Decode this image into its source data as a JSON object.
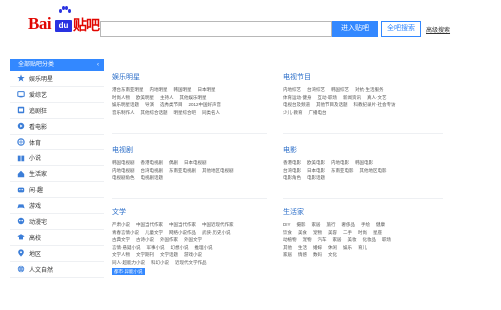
{
  "header": {
    "logo_text_bai": "Bai",
    "logo_text_du": "du",
    "logo_text_tieba": "贴吧",
    "search_placeholder": "",
    "search_button": "进入贴吧",
    "post_button": "全吧搜索",
    "advanced_link": "高级搜索"
  },
  "sidebar": {
    "title": "全部贴吧分类",
    "items": [
      {
        "label": "娱乐明星",
        "icon": "star-icon"
      },
      {
        "label": "爱综艺",
        "icon": "tv-icon"
      },
      {
        "label": "追剧狂",
        "icon": "film-icon"
      },
      {
        "label": "看电影",
        "icon": "video-icon"
      },
      {
        "label": "体育",
        "icon": "ball-icon"
      },
      {
        "label": "小说",
        "icon": "book-icon"
      },
      {
        "label": "生活家",
        "icon": "home-icon"
      },
      {
        "label": "闲·趣",
        "icon": "smile-icon"
      },
      {
        "label": "游戏",
        "icon": "gamepad-icon"
      },
      {
        "label": "动漫宅",
        "icon": "anime-icon"
      },
      {
        "label": "高校",
        "icon": "school-icon"
      },
      {
        "label": "地区",
        "icon": "location-icon"
      },
      {
        "label": "人文自然",
        "icon": "globe-icon"
      }
    ]
  },
  "categories": {
    "ent": {
      "title": "娱乐明星",
      "rows": [
        [
          "港台东南亚明星",
          "内地明星",
          "韩国明星",
          "日本明星"
        ],
        [
          "时尚人物",
          "欧美明星",
          "主持人",
          "其他娱乐明星"
        ],
        [
          "娱乐明星话题",
          "导演",
          "选秀类节目",
          "2012中国好声音"
        ],
        [
          "音乐制作人",
          "其他综合话题",
          "明星综合吧",
          "同类名人"
        ]
      ]
    },
    "tvshow": {
      "title": "电视节目",
      "rows": [
        [
          "内地综艺",
          "台湾综艺",
          "韩国综艺",
          "对抗·生活服务"
        ],
        [
          "体育运动·健身",
          "互动·职场",
          "新闻资讯",
          "真人·文艺"
        ],
        [
          "电视台及频道",
          "其他节目及话题",
          "科教纪录片·社会专访"
        ],
        [
          "少儿·教育",
          "广播电台"
        ]
      ]
    },
    "drama": {
      "title": "电视剧",
      "rows": [
        [
          "韩国电视剧",
          "香港电视剧",
          "偶剧",
          "日本电视剧"
        ],
        [
          "内地电视剧",
          "台湾电视剧",
          "东南亚电视剧",
          "其他地区电视剧"
        ],
        [
          "电视剧角色",
          "电视剧话题"
        ]
      ]
    },
    "movie": {
      "title": "电影",
      "rows": [
        [
          "香港电影",
          "欧美电影",
          "内地电影",
          "韩国电影"
        ],
        [
          "台湾电影",
          "日本电影",
          "东南亚电影",
          "其他地区电影"
        ],
        [
          "电影角色",
          "电影话题"
        ]
      ]
    },
    "literature": {
      "title": "文学",
      "rows": [
        [
          "严肃小说",
          "中国当代作家",
          "中国当代作家",
          "中国近现代作家"
        ],
        [
          "青春言情小说",
          "儿童文学",
          "网络小说作品",
          "武侠·历史小说"
        ],
        [
          "古典文学",
          "古诗小说",
          "外国作家",
          "外国文学"
        ],
        [
          "言情·悬疑小说",
          "军事小说",
          "幻想小说",
          "推理小说"
        ],
        [
          "文学人物",
          "文学期刊",
          "文学话题",
          "游戏小说"
        ],
        [
          "同人·超能力小说",
          "科幻小说",
          "近现代文学作品"
        ],
        [
          "都市·异能小说"
        ]
      ]
    },
    "life": {
      "title": "生活家",
      "rows": [
        [
          "DIY",
          "摄影",
          "家居",
          "旅行",
          "奢侈品",
          "手绘",
          "健康"
        ],
        [
          "饮食",
          "美食",
          "宠物",
          "美容",
          "二手",
          "时尚",
          "星座"
        ],
        [
          "动植物",
          "宠物",
          "汽车",
          "家居",
          "美妆",
          "化妆品",
          "职场"
        ],
        [
          "其他",
          "生活",
          "婚嫁",
          "休闲",
          "娱乐",
          "育儿"
        ],
        [
          "家居",
          "情感",
          "数码",
          "文化"
        ]
      ]
    }
  }
}
